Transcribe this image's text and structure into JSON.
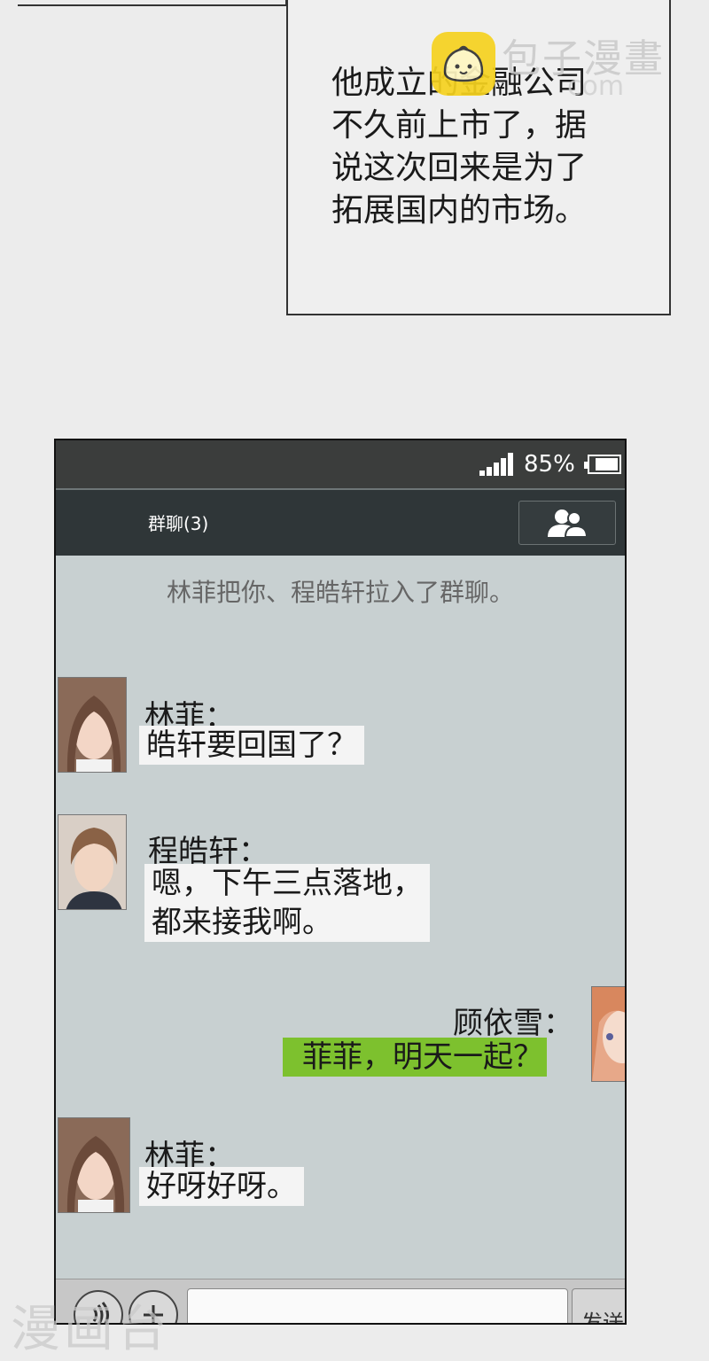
{
  "narration": {
    "lines": [
      "他成立的金融公司",
      "不久前上市了，据",
      "说这次回来是为了",
      "拓展国内的市场。"
    ]
  },
  "watermark": {
    "text": "包子漫畫",
    "sub": "com",
    "bottom": "漫画台"
  },
  "phone": {
    "status": {
      "battery_percent": "85%",
      "signal_bars": 5,
      "battery_level": 0.85
    },
    "header": {
      "title": "群聊(3)",
      "members_icon": "people-icon"
    },
    "system_message": "林菲把你、程皓轩拉入了群聊。",
    "messages": [
      {
        "sender": "林菲：",
        "lines": [
          "皓轩要回国了？"
        ],
        "side": "left"
      },
      {
        "sender": "程皓轩：",
        "lines": [
          "嗯，下午三点落地，",
          "都来接我啊。"
        ],
        "side": "left"
      },
      {
        "sender": "顾依雪：",
        "lines": [
          "菲菲，明天一起？"
        ],
        "side": "right"
      },
      {
        "sender": "林菲：",
        "lines": [
          "好呀好呀。"
        ],
        "side": "left"
      }
    ],
    "input": {
      "voice_icon": "voice-icon",
      "plus_icon": "plus-icon",
      "placeholder": "",
      "send_label": "发送"
    }
  },
  "colors": {
    "outgoing_bubble": "#7dc12e",
    "incoming_bubble": "#f4f4f4",
    "chat_bg": "#c8d0d1",
    "header_bg": "#2f3638"
  }
}
